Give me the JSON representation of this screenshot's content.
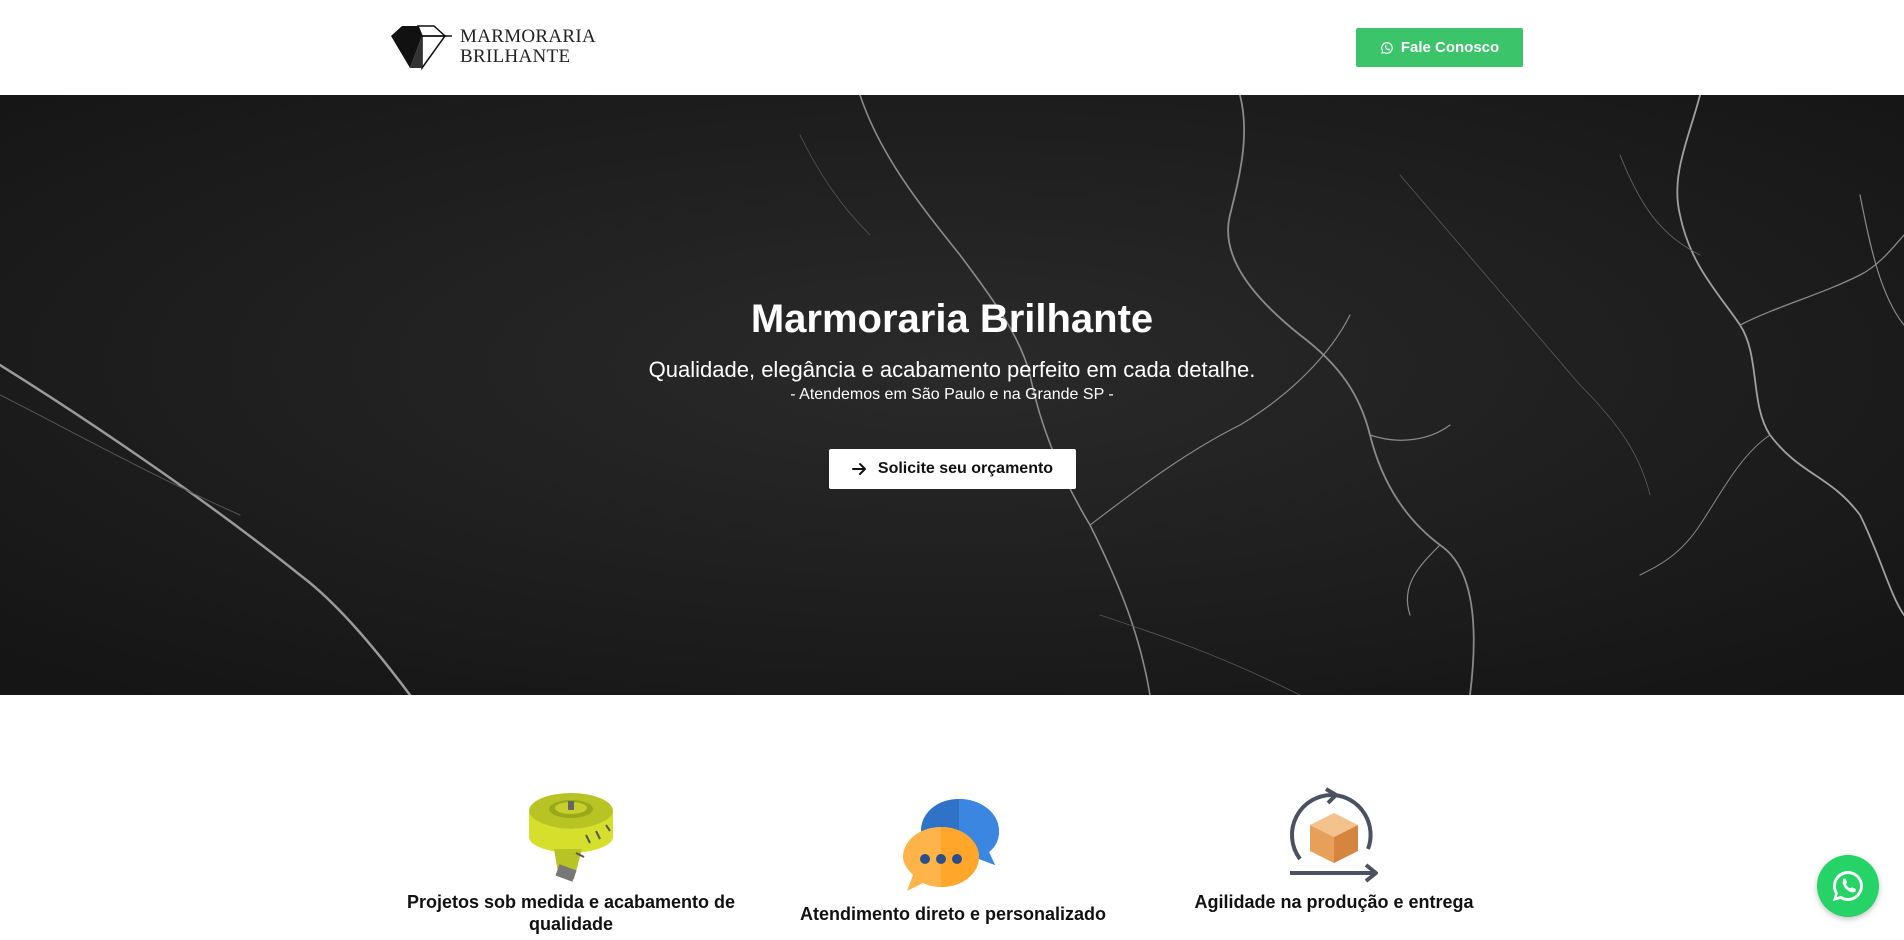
{
  "header": {
    "logo_line1": "MARMORARIA",
    "logo_line2": "BRILHANTE",
    "contact_button": "Fale Conosco",
    "contact_icon": "whatsapp-icon"
  },
  "hero": {
    "title": "Marmoraria Brilhante",
    "subtitle": "Qualidade, elegância e acabamento perfeito em cada detalhe.",
    "note": "- Atendemos em São Paulo e na Grande SP -",
    "cta_label": "Solicite seu orçamento",
    "cta_icon": "arrow-right-icon"
  },
  "features": [
    {
      "icon": "measuring-tape-icon",
      "label": "Projetos sob medida e acabamento de qualidade"
    },
    {
      "icon": "chat-bubbles-icon",
      "label": "Atendimento direto e personalizado"
    },
    {
      "icon": "box-cycle-icon",
      "label": "Agilidade na produção e entrega"
    }
  ],
  "colors": {
    "whatsapp_green": "#3cc46b",
    "hero_background": "#1d1d1d"
  }
}
